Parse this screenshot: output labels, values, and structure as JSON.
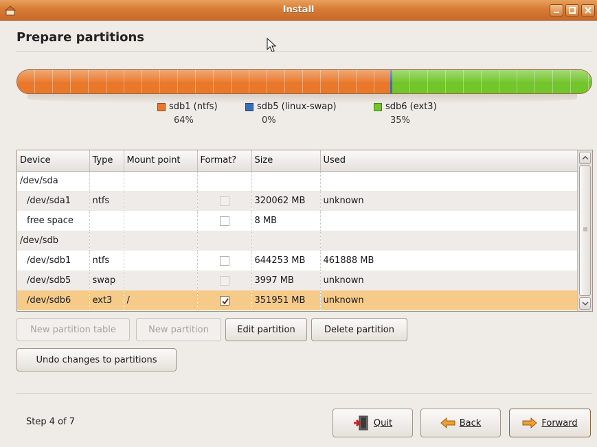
{
  "window": {
    "title": "Install"
  },
  "page": {
    "heading": "Prepare partitions"
  },
  "partition_bar": {
    "segments": [
      {
        "label": "sdb1 (ntfs)",
        "percent_label": "64%",
        "fraction": 0.649,
        "color": "#e9782a"
      },
      {
        "label": "sdb5 (linux-swap)",
        "percent_label": "0%",
        "fraction": 0.004,
        "color": "#3a6fb8"
      },
      {
        "label": "sdb6 (ext3)",
        "percent_label": "35%",
        "fraction": 0.347,
        "color": "#72c52a"
      }
    ]
  },
  "table": {
    "columns": [
      "Device",
      "Type",
      "Mount point",
      "Format?",
      "Size",
      "Used"
    ],
    "rows": [
      {
        "device": "/dev/sda",
        "type": "",
        "mount": "",
        "format": "none",
        "size": "",
        "used": ""
      },
      {
        "device": "/dev/sda1",
        "type": "ntfs",
        "mount": "",
        "format": "disabled",
        "size": "320062 MB",
        "used": "unknown"
      },
      {
        "device": "free space",
        "type": "",
        "mount": "",
        "format": "unchecked",
        "size": "8 MB",
        "used": ""
      },
      {
        "device": "/dev/sdb",
        "type": "",
        "mount": "",
        "format": "none",
        "size": "",
        "used": ""
      },
      {
        "device": "/dev/sdb1",
        "type": "ntfs",
        "mount": "",
        "format": "unchecked",
        "size": "644253 MB",
        "used": "461888 MB"
      },
      {
        "device": "/dev/sdb5",
        "type": "swap",
        "mount": "",
        "format": "disabled",
        "size": "3997 MB",
        "used": "unknown"
      },
      {
        "device": "/dev/sdb6",
        "type": "ext3",
        "mount": "/",
        "format": "checked",
        "size": "351951 MB",
        "used": "unknown",
        "selected": true
      }
    ]
  },
  "actions": {
    "new_partition_table": "New partition table",
    "new_partition": "New partition",
    "edit_partition": "Edit partition",
    "delete_partition": "Delete partition",
    "undo_changes": "Undo changes to partitions"
  },
  "footer": {
    "step": "Step 4 of 7",
    "quit": "Quit",
    "back": "Back",
    "forward": "Forward"
  },
  "colors": {
    "titlebar": "#d77c35",
    "selection": "#f6cb8a"
  }
}
